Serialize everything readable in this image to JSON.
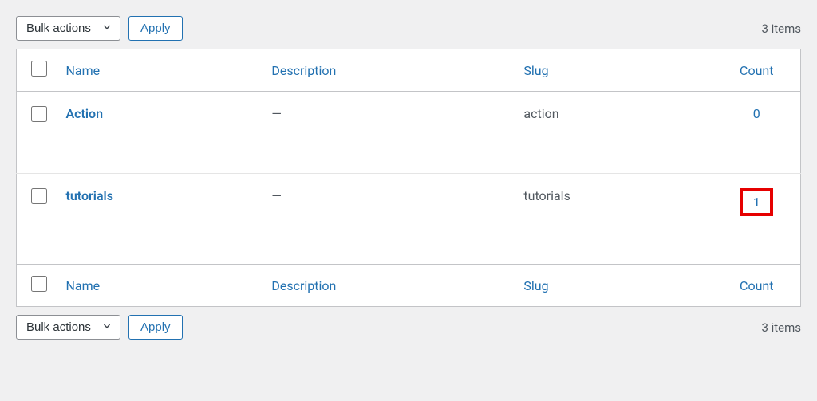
{
  "bulk": {
    "label": "Bulk actions",
    "apply": "Apply"
  },
  "itemsText": "3 items",
  "columns": {
    "name": "Name",
    "description": "Description",
    "slug": "Slug",
    "count": "Count"
  },
  "rows": [
    {
      "name": "Action",
      "description": "—",
      "slug": "action",
      "count": "0",
      "highlight": false
    },
    {
      "name": "tutorials",
      "description": "—",
      "slug": "tutorials",
      "count": "1",
      "highlight": true
    }
  ]
}
